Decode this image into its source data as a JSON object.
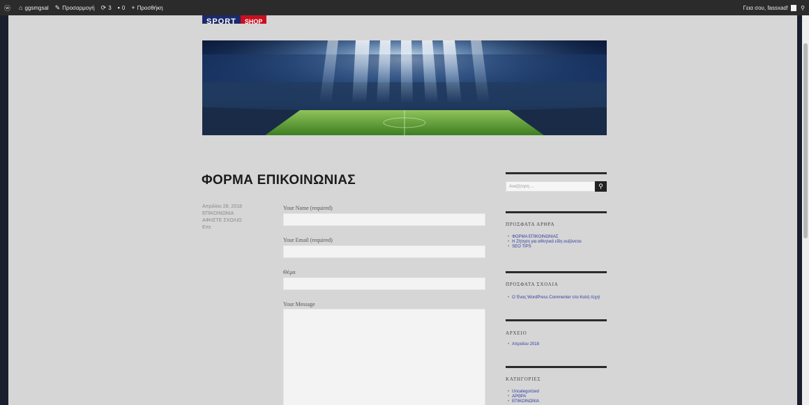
{
  "adminbar": {
    "items": [
      {
        "icon": "wordpress-icon",
        "glyph": "ⓦ",
        "label": ""
      },
      {
        "icon": "home-icon",
        "glyph": "⌂",
        "label": "ggsmgsal"
      },
      {
        "icon": "pencil-icon",
        "glyph": "✎",
        "label": "Προσαρμογή"
      },
      {
        "icon": "refresh-icon",
        "glyph": "⟳",
        "label": "3"
      },
      {
        "icon": "comment-icon",
        "glyph": "▪",
        "label": "0"
      },
      {
        "icon": "plus-icon",
        "glyph": "+",
        "label": "Προσθήκη"
      }
    ],
    "greeting": "Γεια σου, fassxad!",
    "search_glyph": "⚲"
  },
  "logo": {
    "part1": "SPORT",
    "part2": "SHOP"
  },
  "page": {
    "title": "ΦΟΡΜΑ ΕΠΙΚΟΙΝΩΝΙΑΣ"
  },
  "meta": {
    "date": "Απριλίου 28, 2018",
    "lines": [
      "ΕΠΙΚΟΙΝΩΝΙΑ",
      "ΑΦΗΣΤΕ ΣΧΟΛΙΟ",
      "Επε"
    ]
  },
  "form": {
    "name_label": "Your Name (required)",
    "email_label": "Your Email (required)",
    "subject_label": "Θέμα",
    "message_label": "Your Message"
  },
  "sidebar": {
    "search_placeholder": "Αναζήτηση …",
    "search_glyph": "⚲",
    "recent_posts": {
      "title": "ΠΡΟΣΦΑΤΑ ΑΡΘΡΑ",
      "items": [
        "ΦΟΡΜΑ ΕΠΙΚΟΙΝΩΝΙΑΣ",
        "Η Ζήτηση για αθλητικά είδη αυξάνεται",
        "SEO TIPS"
      ]
    },
    "recent_comments": {
      "title": "ΠΡΟΣΦΑΤΑ ΣΧΟΛΙΑ",
      "items": [
        "Ο Ένας WordPress Commenter στο Καλή τύχη!"
      ]
    },
    "archives": {
      "title": "ΑΡΧΕΙΟ",
      "items": [
        "Απριλίου 2018"
      ]
    },
    "categories": {
      "title": "ΚΑΤΗΓΟΡΙΕΣ",
      "items": [
        "Uncategorized",
        "ΑΡΘΡΑ",
        "ΕΠΙΚΟΙΝΩΝΙΑ"
      ]
    }
  },
  "colors": {
    "admin_bar": "#2b2b2b",
    "page_bg": "#d6d6d6",
    "link": "#2f3ea0",
    "logo_blue": "#1c2a6b",
    "logo_red": "#c8101e"
  }
}
